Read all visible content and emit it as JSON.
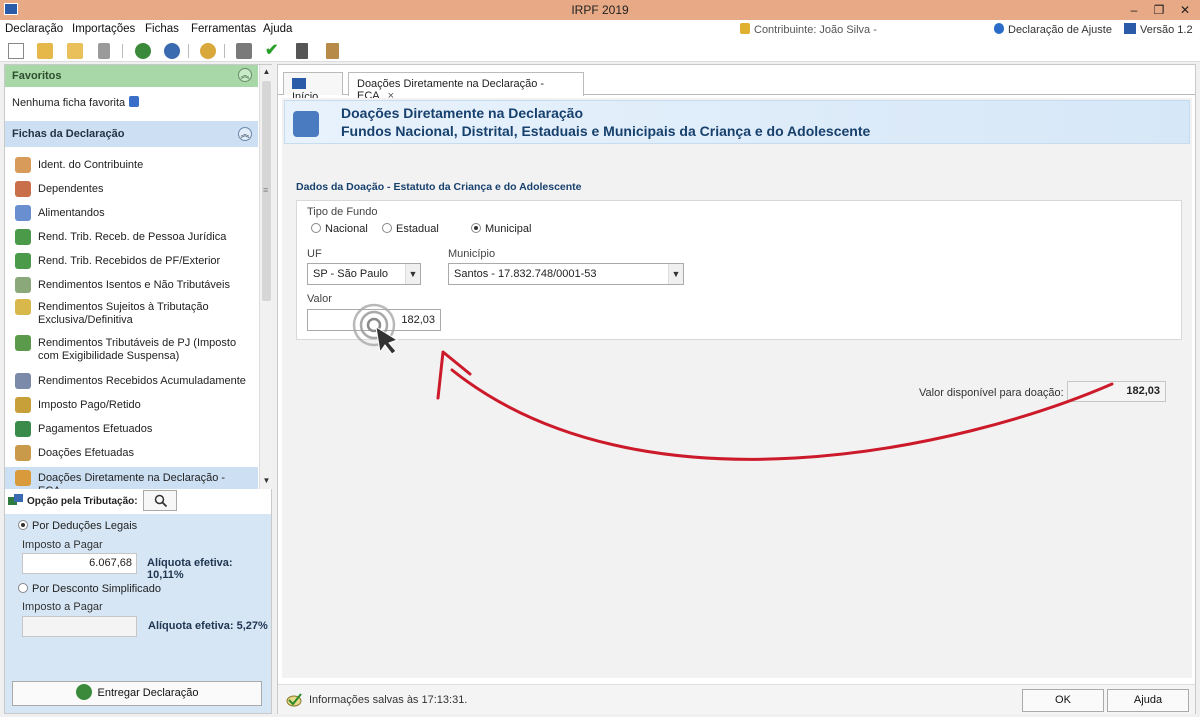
{
  "window": {
    "title": "IRPF 2019",
    "minimize": "–",
    "restore": "❐",
    "close": "✕"
  },
  "menu": {
    "items": [
      "Declaração",
      "Importações",
      "Fichas",
      "Ferramentas",
      "Ajuda"
    ],
    "contribuinte": "Contribuinte: João Silva -",
    "declaracao": "Declaração de Ajuste",
    "versao": "Versão 1.2"
  },
  "favoritos": {
    "title": "Favoritos",
    "empty": "Nenhuma ficha favorita"
  },
  "fichas": {
    "title": "Fichas da Declaração",
    "items": [
      {
        "label": "Ident. do Contribuinte",
        "icon": "person-icon",
        "color": "#d99b5a"
      },
      {
        "label": "Dependentes",
        "icon": "dependents-icon",
        "color": "#c9704a"
      },
      {
        "label": "Alimentandos",
        "icon": "alimentandos-icon",
        "color": "#6a8fd0"
      },
      {
        "label": "Rend. Trib. Receb. de Pessoa Jurídica",
        "icon": "money-in-icon",
        "color": "#4a9a4a"
      },
      {
        "label": "Rend. Trib. Recebidos de PF/Exterior",
        "icon": "money-world-icon",
        "color": "#4a9a4a"
      },
      {
        "label": "Rendimentos Isentos e Não Tributáveis",
        "icon": "doc-check-icon",
        "color": "#8aa87a"
      },
      {
        "label": "Rendimentos Sujeitos à Tributação Exclusiva/Definitiva",
        "icon": "doc-warning-icon",
        "color": "#d8b84a"
      },
      {
        "label": "Rendimentos Tributáveis de PJ (Imposto com Exigibilidade Suspensa)",
        "icon": "money-warning-icon",
        "color": "#5a9a4a"
      },
      {
        "label": "Rendimentos Recebidos Acumuladamente",
        "icon": "doc-clock-icon",
        "color": "#7a8aa8"
      },
      {
        "label": "Imposto Pago/Retido",
        "icon": "tax-paid-icon",
        "color": "#c8a03a"
      },
      {
        "label": "Pagamentos Efetuados",
        "icon": "card-icon",
        "color": "#3a8a4a"
      },
      {
        "label": "Doações Efetuadas",
        "icon": "donation-icon",
        "color": "#c89a4a"
      },
      {
        "label": "Doações Diretamente na Declaração - ECA",
        "icon": "eca-icon",
        "color": "#d89a3a"
      }
    ]
  },
  "tributacao": {
    "title": "Opção pela Tributação:",
    "deducoes": "Por Deduções Legais",
    "imposto_label": "Imposto a Pagar",
    "imposto_deducoes": "6.067,68",
    "aliquota_deducoes": "Alíquota efetiva: 10,11%",
    "simplificado": "Por Desconto Simplificado",
    "imposto_label2": "Imposto a Pagar",
    "imposto_simplificado": "",
    "aliquota_simplificado": "Alíquota efetiva: 5,27%",
    "entregar": "Entregar Declaração"
  },
  "tabs": [
    {
      "label": "Início"
    },
    {
      "label": "Doações Diretamente na Declaração - ECA",
      "close": "×"
    }
  ],
  "banner": {
    "line1": "Doações Diretamente na Declaração",
    "line2": "Fundos Nacional, Distrital, Estaduais e Municipais da Criança e do Adolescente"
  },
  "form": {
    "section": "Dados da Doação - Estatuto da Criança e do Adolescente",
    "tipo_label": "Tipo de Fundo",
    "options": [
      "Nacional",
      "Estadual",
      "Municipal"
    ],
    "selected_option": "Municipal",
    "uf_label": "UF",
    "uf_value": "SP - São Paulo",
    "municipio_label": "Município",
    "municipio_value": "Santos - 17.832.748/0001-53",
    "valor_label": "Valor",
    "valor_value": "182,03",
    "disponivel_label": "Valor disponível para doação:",
    "disponivel_value": "182,03"
  },
  "status": {
    "message": "Informações salvas às 17:13:31.",
    "ok": "OK",
    "ajuda": "Ajuda"
  },
  "colors": {
    "annotation_arrow": "#cc1a2a",
    "banner_text": "#17406d"
  }
}
